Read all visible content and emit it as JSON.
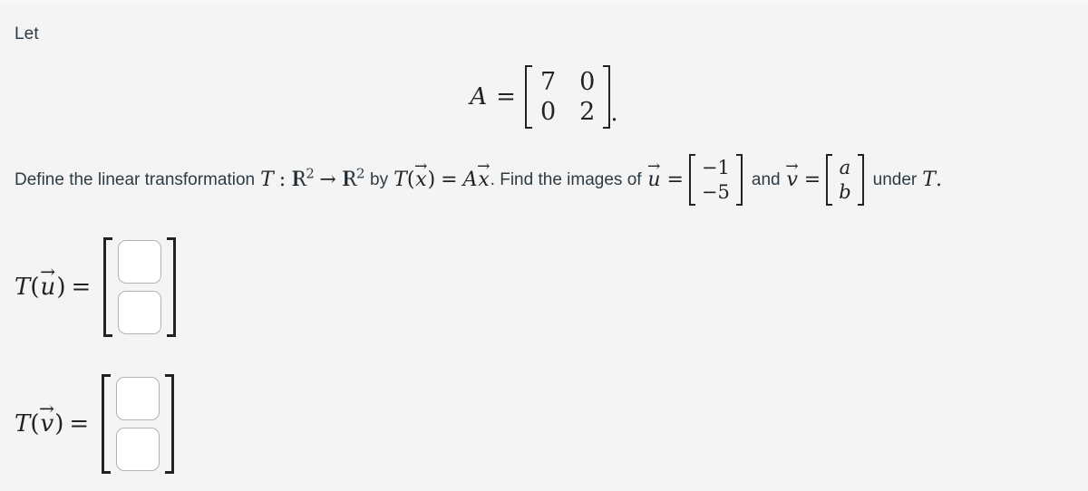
{
  "background_color": "#f4f4f4",
  "text_color": "#2d3b45",
  "math_color": "#1f2326",
  "intro": {
    "text": "Let"
  },
  "matrix_A": {
    "name": "A",
    "equals": "=",
    "rows": [
      [
        "7",
        "0"
      ],
      [
        "0",
        "2"
      ]
    ],
    "trailing_punctuation": "."
  },
  "problem": {
    "part1": "Define the linear transformation",
    "transformation_symbol": "T",
    "colon": ":",
    "domain": "R",
    "domain_exponent": "2",
    "arrow": "→",
    "codomain": "R",
    "codomain_exponent": "2",
    "part2": "by",
    "map_lhs_fn": "T",
    "map_lhs_arg": "x",
    "equals": "=",
    "map_rhs_matrix": "A",
    "map_rhs_vector": "x",
    "part3": ". Find the images of",
    "vector_u_symbol": "u",
    "vector_u_entries": [
      "−1",
      "−5"
    ],
    "conjunction": "and",
    "vector_v_symbol": "v",
    "vector_v_entries": [
      "a",
      "b"
    ],
    "part4": "under",
    "closing_symbol": "T",
    "closing_punctuation": "."
  },
  "answers": [
    {
      "label_fn": "T",
      "label_arg": "u",
      "label_equals": "=",
      "inputs": [
        {
          "value": "",
          "placeholder": ""
        },
        {
          "value": "",
          "placeholder": ""
        }
      ]
    },
    {
      "label_fn": "T",
      "label_arg": "v",
      "label_equals": "=",
      "inputs": [
        {
          "value": "",
          "placeholder": ""
        },
        {
          "value": "",
          "placeholder": ""
        }
      ]
    }
  ],
  "glyphs": {
    "vector_arrow": "→",
    "bracket_left": "[",
    "bracket_right": "]"
  }
}
